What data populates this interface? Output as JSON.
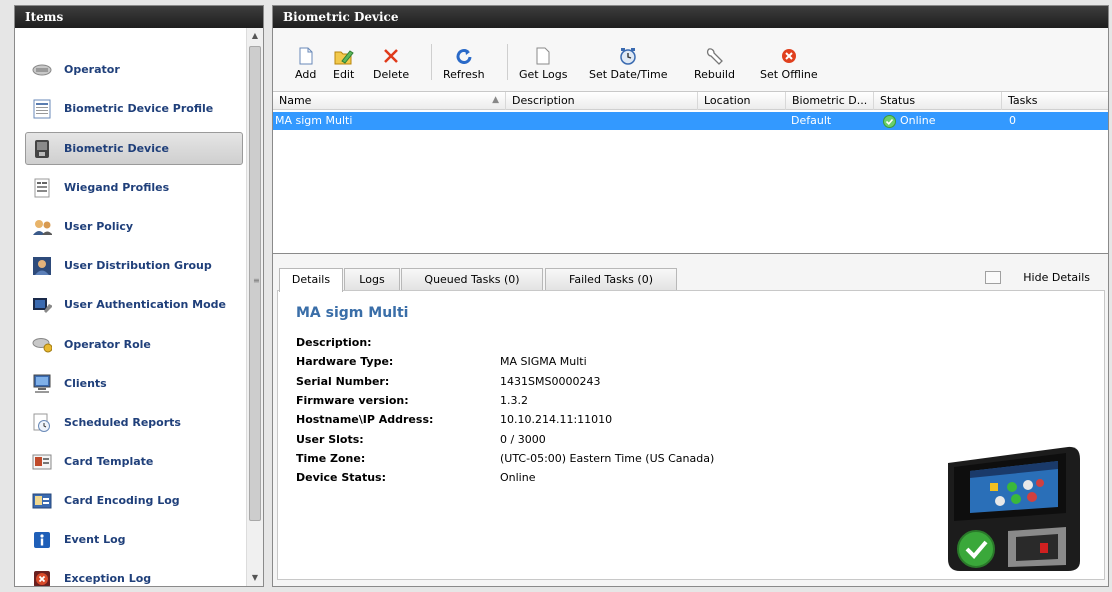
{
  "sidebar": {
    "title": "Items",
    "items": [
      {
        "label": "Operator",
        "icon": "operator-icon"
      },
      {
        "label": "Biometric Device Profile",
        "icon": "profile-icon"
      },
      {
        "label": "Biometric Device",
        "icon": "biometric-device-icon",
        "selected": true
      },
      {
        "label": "Wiegand Profiles",
        "icon": "wiegand-icon"
      },
      {
        "label": "User Policy",
        "icon": "user-policy-icon"
      },
      {
        "label": "User Distribution Group",
        "icon": "distribution-group-icon"
      },
      {
        "label": "User Authentication Mode",
        "icon": "authentication-icon"
      },
      {
        "label": "Operator Role",
        "icon": "operator-role-icon"
      },
      {
        "label": "Clients",
        "icon": "clients-icon"
      },
      {
        "label": "Scheduled Reports",
        "icon": "scheduled-reports-icon"
      },
      {
        "label": "Card Template",
        "icon": "card-template-icon"
      },
      {
        "label": "Card Encoding Log",
        "icon": "card-encoding-icon"
      },
      {
        "label": "Event Log",
        "icon": "info-icon"
      },
      {
        "label": "Exception Log",
        "icon": "error-icon"
      }
    ]
  },
  "main": {
    "title": "Biometric Device",
    "toolbar": {
      "add": "Add",
      "edit": "Edit",
      "delete": "Delete",
      "refresh": "Refresh",
      "get_logs": "Get Logs",
      "set_date_time": "Set Date/Time",
      "rebuild": "Rebuild",
      "set_offline": "Set Offline"
    },
    "grid": {
      "columns": [
        "Name",
        "Description",
        "Location",
        "Biometric D...",
        "Status",
        "Tasks"
      ],
      "rows": [
        {
          "name": "MA sigm Multi",
          "description": "",
          "location": "",
          "biometric": "Default",
          "status": "Online",
          "tasks": "0"
        }
      ]
    },
    "tabs": [
      "Details",
      "Logs",
      "Queued Tasks (0)",
      "Failed Tasks (0)"
    ],
    "hide_details": "Hide Details",
    "details": {
      "title": "MA sigm Multi",
      "fields": [
        {
          "key": "Description:",
          "value": ""
        },
        {
          "key": "Hardware Type:",
          "value": "MA SIGMA Multi"
        },
        {
          "key": "Serial Number:",
          "value": "1431SMS0000243"
        },
        {
          "key": "Firmware version:",
          "value": "1.3.2"
        },
        {
          "key": "Hostname\\IP Address:",
          "value": "10.10.214.11:11010"
        },
        {
          "key": "User Slots:",
          "value": "0 / 3000"
        },
        {
          "key": "Time Zone:",
          "value": "(UTC-05:00) Eastern Time (US  Canada)"
        },
        {
          "key": "Device Status:",
          "value": "Online"
        }
      ]
    }
  },
  "colors": {
    "selection": "#3399ff",
    "nav_text": "#1f3f7a",
    "detail_title": "#3a6ea8",
    "header_dark": "#2a2a2a"
  }
}
